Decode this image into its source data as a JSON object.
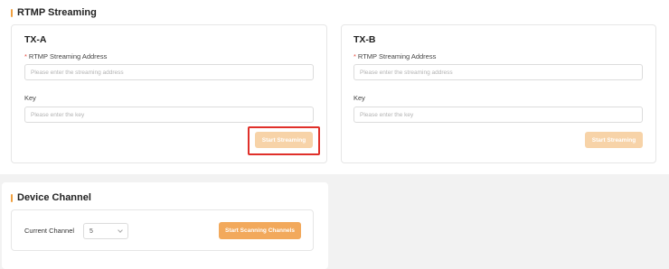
{
  "streaming": {
    "title": "RTMP Streaming",
    "tx_a": {
      "title": "TX-A",
      "address_label": "RTMP Streaming Address",
      "address_required": "*",
      "address_placeholder": "Please enter the streaming address",
      "key_label": "Key",
      "key_placeholder": "Please enter the key",
      "start_label": "Start Streaming"
    },
    "tx_b": {
      "title": "TX-B",
      "address_label": "RTMP Streaming Address",
      "address_required": "*",
      "address_placeholder": "Please enter the streaming address",
      "key_label": "Key",
      "key_placeholder": "Please enter the key",
      "start_label": "Start Streaming"
    }
  },
  "device": {
    "title": "Device Channel",
    "current_channel_label": "Current Channel",
    "current_channel_value": "5",
    "scan_label": "Start Scanning Channels"
  },
  "colors": {
    "accent": "#f2a95c",
    "accent_disabled": "#f7d3a8",
    "highlight": "#e0302a",
    "required": "#e5483b"
  }
}
